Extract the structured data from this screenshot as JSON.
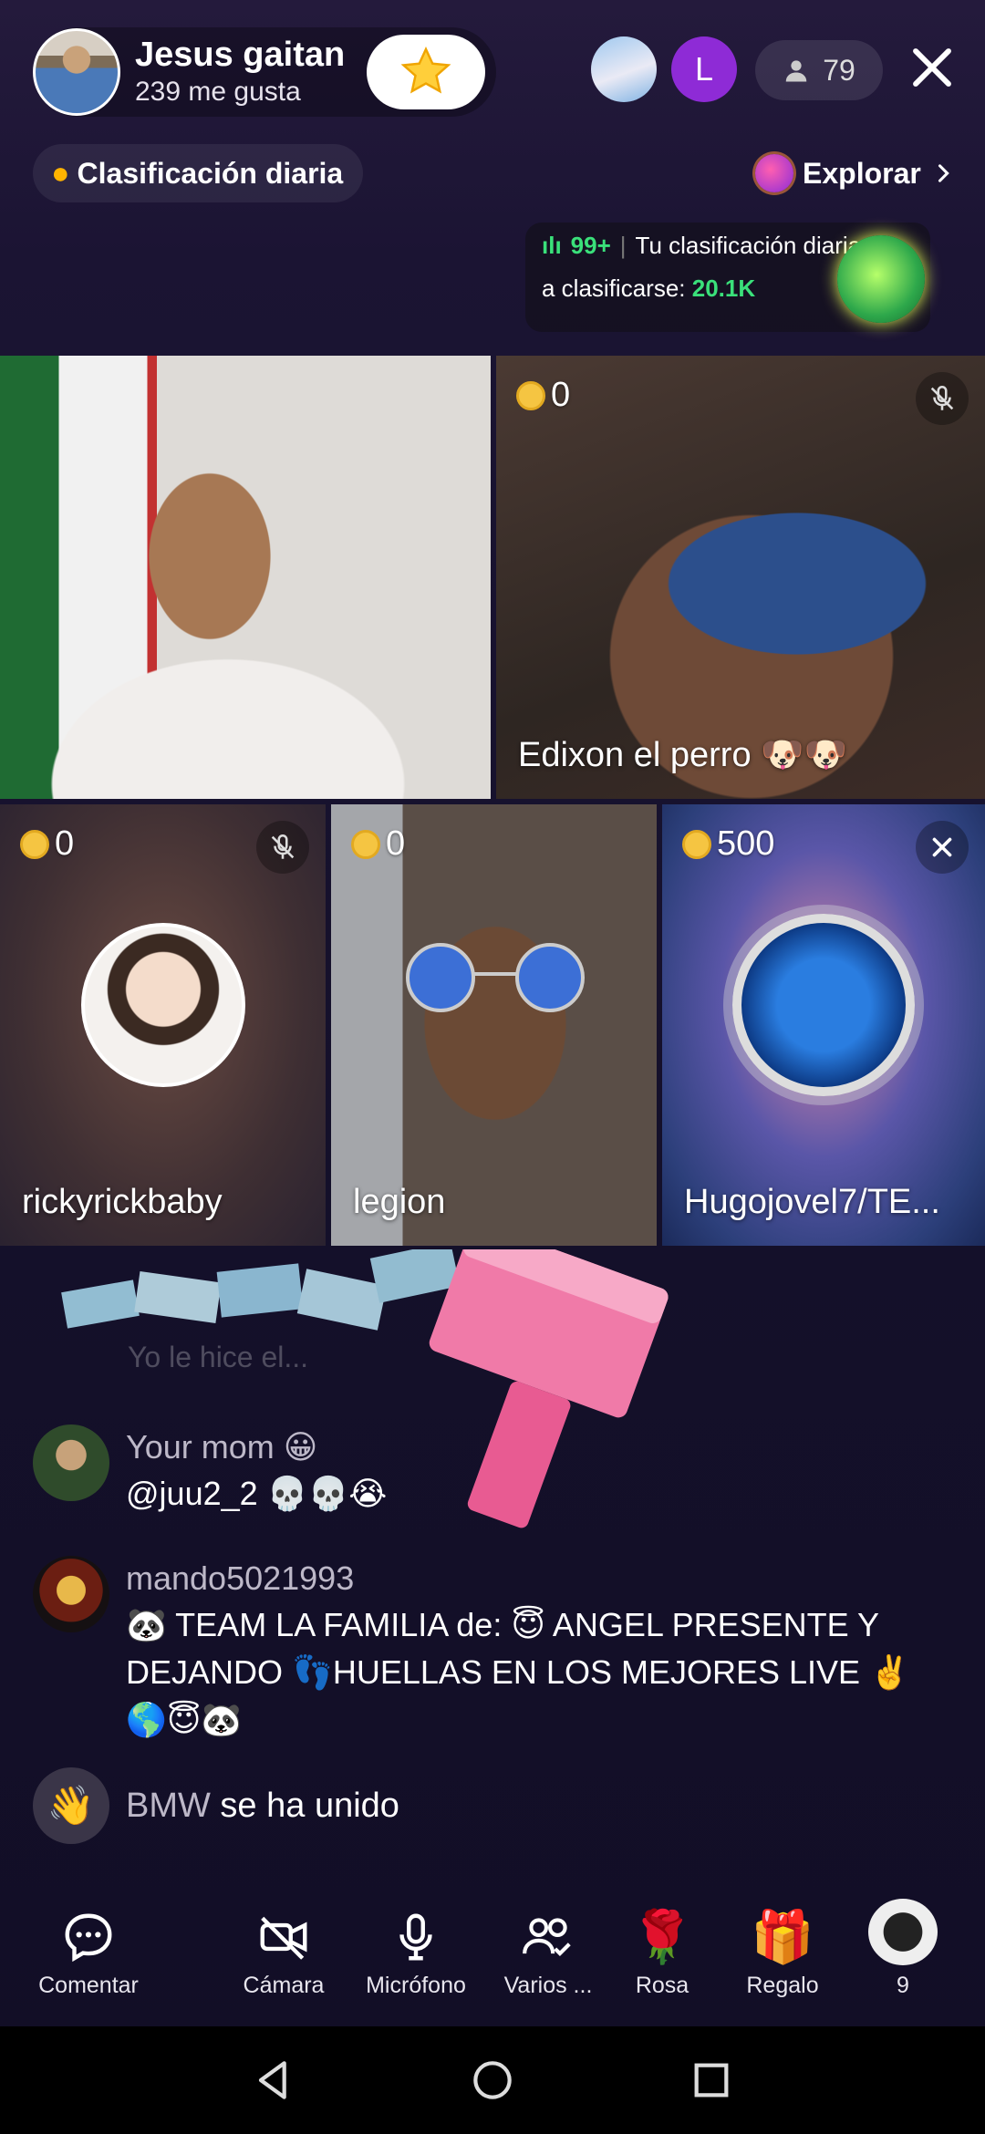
{
  "host": {
    "name": "Jesus gaitan",
    "likes": "239 me gusta",
    "avatar_icon": "host-avatar",
    "follow_icon": "star-icon"
  },
  "top_viewers": [
    {
      "icon": "messi-avatar",
      "initial": ""
    },
    {
      "icon": "letter-avatar",
      "initial": "L"
    }
  ],
  "viewer_count": "79",
  "rank_chip": "Clasificación diaria",
  "explore": "Explorar",
  "ranking_card": {
    "position": "99+",
    "title": "Tu clasificación diaria",
    "line2_prefix": "a clasificarse: ",
    "line2_value": "20.1K"
  },
  "tiles": [
    {
      "id": "host",
      "name": "",
      "coins": ""
    },
    {
      "id": "guest1",
      "name": "Edixon el perro 🐶🐶",
      "coins": "0",
      "muted": true
    },
    {
      "id": "guest2",
      "name": "rickyrickbaby",
      "coins": "0",
      "muted": true
    },
    {
      "id": "guest3",
      "name": "legion",
      "coins": "0",
      "muted": false
    },
    {
      "id": "guest4",
      "name": "Hugojovel7/TE...",
      "coins": "500",
      "closable": true
    }
  ],
  "chat": {
    "faded_line": "Yo le hice el...",
    "messages": [
      {
        "user": "Your mom 😀",
        "text": "@juu2_2 💀💀😭"
      },
      {
        "user": "mando5021993",
        "text": "🐼 TEAM LA FAMILIA de:  😇 ANGEL PRESENTE Y DEJANDO 👣HUELLAS EN LOS MEJORES LIVE ✌️🌎😇🐼"
      }
    ],
    "joined": {
      "user": "BMW",
      "text": " se ha unido"
    }
  },
  "actions": [
    {
      "label": "Comentar",
      "icon": "comment-icon"
    },
    {
      "label": "Cámara",
      "icon": "camera-off-icon"
    },
    {
      "label": "Micrófono",
      "icon": "microphone-icon"
    },
    {
      "label": "Varios ...",
      "icon": "multi-guest-icon"
    },
    {
      "label": "Rosa",
      "icon": "rose-icon"
    },
    {
      "label": "Regalo",
      "icon": "gift-icon"
    },
    {
      "label": "9",
      "icon": "profile-avatar"
    }
  ],
  "colors": {
    "accent_green": "#3ae07a",
    "coin": "#f5c542",
    "background": "#14102a"
  }
}
